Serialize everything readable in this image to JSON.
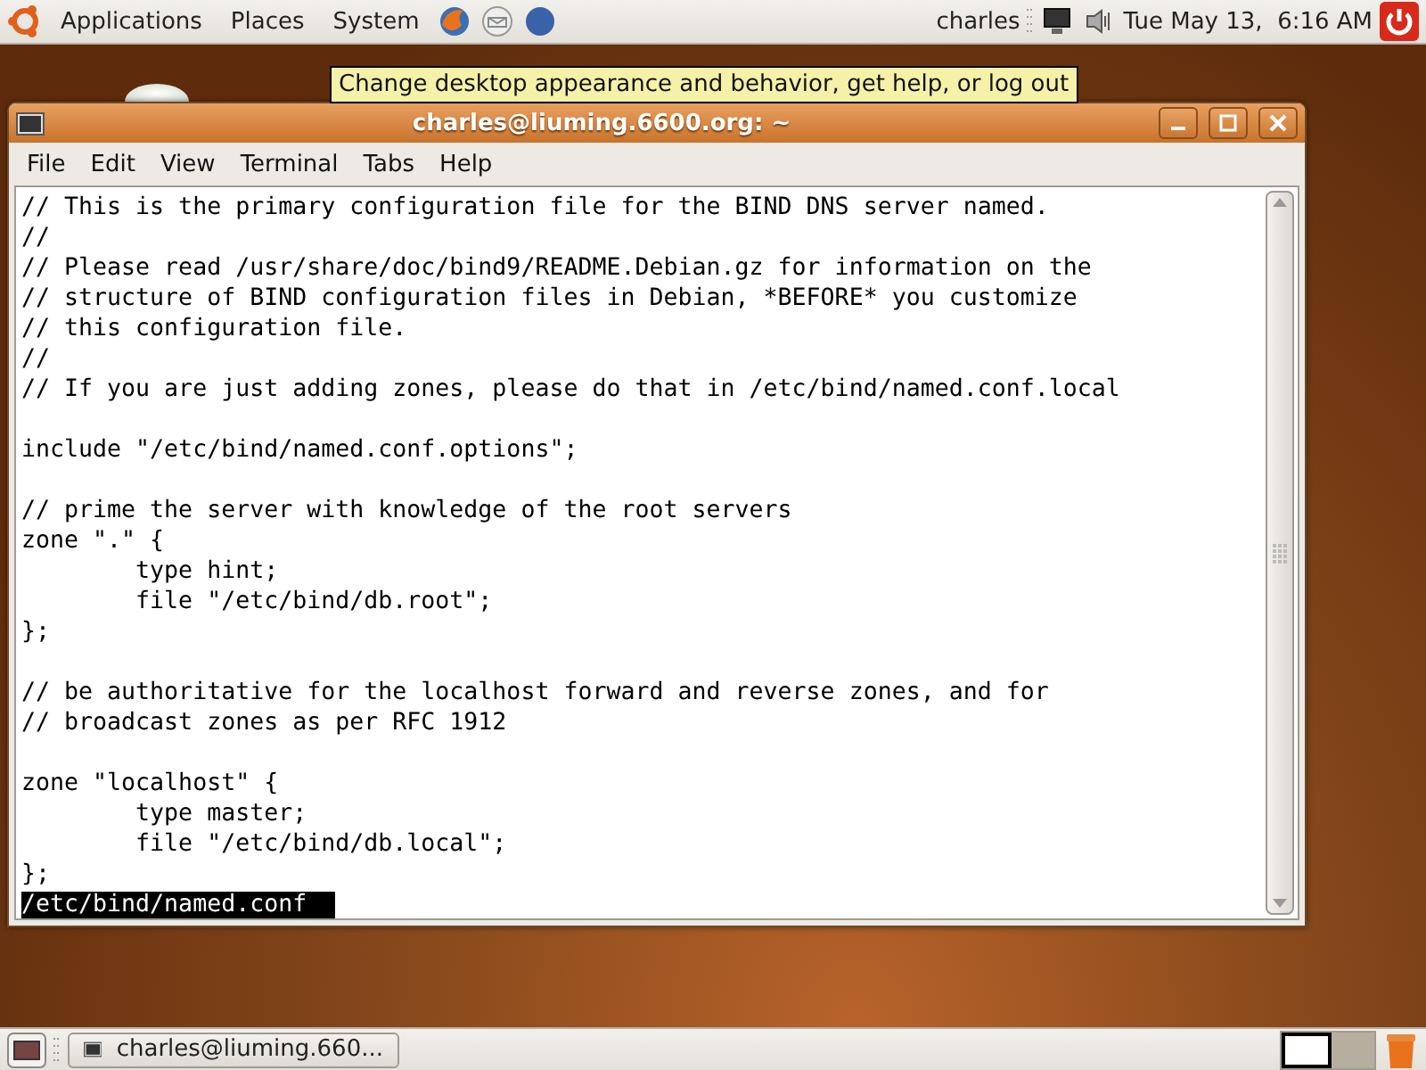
{
  "top_panel": {
    "menus": [
      {
        "label": "Applications"
      },
      {
        "label": "Places"
      },
      {
        "label": "System"
      }
    ],
    "user": "charles",
    "clock": "Tue May 13,  6:16 AM"
  },
  "tooltip": "Change desktop appearance and behavior, get help, or log out",
  "window": {
    "title": "charles@liuming.6600.org: ~",
    "menu": [
      {
        "label": "File"
      },
      {
        "label": "Edit"
      },
      {
        "label": "View"
      },
      {
        "label": "Terminal"
      },
      {
        "label": "Tabs"
      },
      {
        "label": "Help"
      }
    ],
    "lines": [
      {
        "kind": "text",
        "text": "// This is the primary configuration file for the BIND DNS server named."
      },
      {
        "kind": "text",
        "text": "//"
      },
      {
        "kind": "text",
        "text": "// Please read /usr/share/doc/bind9/README.Debian.gz for information on the"
      },
      {
        "kind": "text",
        "text": "// structure of BIND configuration files in Debian, *BEFORE* you customize"
      },
      {
        "kind": "text",
        "text": "// this configuration file."
      },
      {
        "kind": "text",
        "text": "//"
      },
      {
        "kind": "text",
        "text": "// If you are just adding zones, please do that in /etc/bind/named.conf.local"
      },
      {
        "kind": "blank"
      },
      {
        "kind": "text",
        "text": "include \"/etc/bind/named.conf.options\";"
      },
      {
        "kind": "blank"
      },
      {
        "kind": "text",
        "text": "// prime the server with knowledge of the root servers"
      },
      {
        "kind": "text",
        "text": "zone \".\" {"
      },
      {
        "kind": "text",
        "text": "        type hint;"
      },
      {
        "kind": "text",
        "text": "        file \"/etc/bind/db.root\";"
      },
      {
        "kind": "text",
        "text": "};"
      },
      {
        "kind": "blank"
      },
      {
        "kind": "text",
        "text": "// be authoritative for the localhost forward and reverse zones, and for"
      },
      {
        "kind": "text",
        "text": "// broadcast zones as per RFC 1912"
      },
      {
        "kind": "blank"
      },
      {
        "kind": "text",
        "text": "zone \"localhost\" {"
      },
      {
        "kind": "text",
        "text": "        type master;"
      },
      {
        "kind": "text",
        "text": "        file \"/etc/bind/db.local\";"
      },
      {
        "kind": "text",
        "text": "};"
      },
      {
        "kind": "status",
        "text": "/etc/bind/named.conf  "
      }
    ]
  },
  "bottom_panel": {
    "tasks": [
      {
        "label": "charles@liuming.660...",
        "selected": false
      }
    ]
  }
}
